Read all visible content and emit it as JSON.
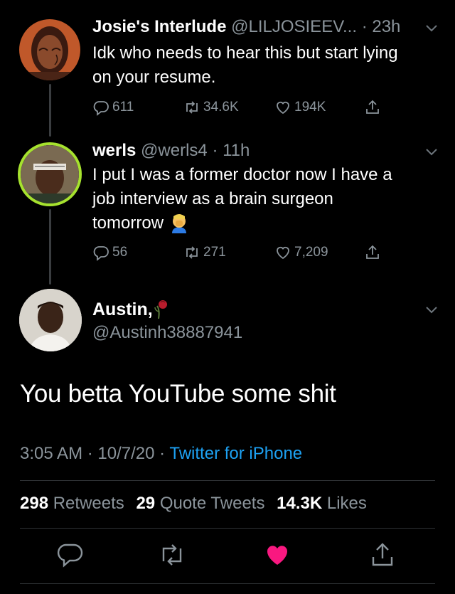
{
  "tweets": [
    {
      "name": "Josie's Interlude",
      "handle": "@LILJOSIEEV...",
      "time": "23h",
      "lines": [
        "Idk who needs to hear this but start lying",
        "on your resume."
      ],
      "replies": "611",
      "retweets": "34.6K",
      "likes": "194K"
    },
    {
      "name": "werls",
      "handle": "@werls4",
      "time": "11h",
      "lines": [
        "I put I was a former doctor  now I have a",
        "job interview as a brain surgeon",
        "tomorrow"
      ],
      "emoji": "facepalm-emoji",
      "replies": "56",
      "retweets": "271",
      "likes": "7,209"
    }
  ],
  "main": {
    "name": "Austin,",
    "name_emoji": "wilted-rose-emoji",
    "handle": "@Austinh38887941",
    "text": "You betta YouTube some shit",
    "time": "3:05 AM",
    "date": "10/7/20",
    "source": "Twitter for iPhone",
    "retweets_count": "298",
    "retweets_label": "Retweets",
    "quotes_count": "29",
    "quotes_label": "Quote Tweets",
    "likes_count": "14.3K",
    "likes_label": "Likes"
  },
  "colors": {
    "background": "#000000",
    "muted": "#8b949b",
    "link": "#1da1f2",
    "like": "#f91880",
    "avatar_ring": "#a6e22e"
  },
  "icons": [
    "reply-icon",
    "retweet-icon",
    "like-icon",
    "share-icon",
    "chevron-down-icon"
  ],
  "separator": "·"
}
